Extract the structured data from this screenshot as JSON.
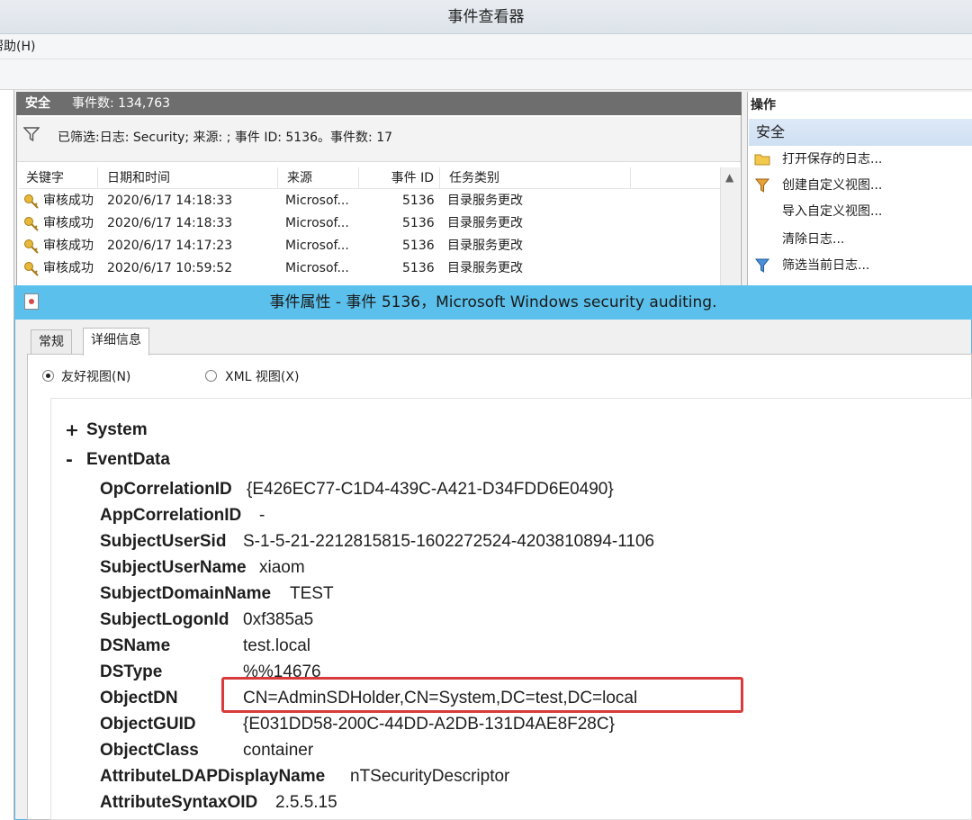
{
  "window": {
    "title": "事件查看器"
  },
  "menu": {
    "help": "帮助(H)"
  },
  "log_pane": {
    "name": "安全",
    "event_count": "事件数: 134,763",
    "filter_text": "已筛选:日志: Security; 来源: ; 事件 ID: 5136。事件数: 17",
    "columns": [
      "关键字",
      "日期和时间",
      "来源",
      "事件 ID",
      "任务类别"
    ],
    "rows": [
      {
        "keyword": "审核成功",
        "datetime": "2020/6/17 14:18:33",
        "source": "Microsof...",
        "event_id": "5136",
        "category": "目录服务更改"
      },
      {
        "keyword": "审核成功",
        "datetime": "2020/6/17 14:18:33",
        "source": "Microsof...",
        "event_id": "5136",
        "category": "目录服务更改"
      },
      {
        "keyword": "审核成功",
        "datetime": "2020/6/17 14:17:23",
        "source": "Microsof...",
        "event_id": "5136",
        "category": "目录服务更改"
      },
      {
        "keyword": "审核成功",
        "datetime": "2020/6/17 10:59:52",
        "source": "Microsof...",
        "event_id": "5136",
        "category": "目录服务更改"
      }
    ]
  },
  "actions": {
    "title": "操作",
    "section": "安全",
    "items": [
      "打开保存的日志...",
      "创建自定义视图...",
      "导入自定义视图...",
      "清除日志...",
      "筛选当前日志..."
    ]
  },
  "dialog": {
    "title": "事件属性 - 事件 5136，Microsoft Windows security auditing.",
    "tabs": [
      "常规",
      "详细信息"
    ],
    "radio_friendly": "友好视图(N)",
    "radio_xml": "XML 视图(X)",
    "system_label": "System",
    "eventdata_label": "EventData",
    "system_toggle": "+",
    "eventdata_toggle": "-",
    "fields": [
      {
        "key": "OpCorrelationID",
        "value": "{E426EC77-C1D4-439C-A421-D34FDD6E0490}"
      },
      {
        "key": "AppCorrelationID",
        "value": "-"
      },
      {
        "key": "SubjectUserSid",
        "value": "S-1-5-21-2212815815-1602272524-4203810894-1106"
      },
      {
        "key": "SubjectUserName",
        "value": "xiaom"
      },
      {
        "key": "SubjectDomainName",
        "value": "TEST"
      },
      {
        "key": "SubjectLogonId",
        "value": "0xf385a5"
      },
      {
        "key": "DSName",
        "value": "test.local"
      },
      {
        "key": "DSType",
        "value": "%%14676"
      },
      {
        "key": "ObjectDN",
        "value": "CN=AdminSDHolder,CN=System,DC=test,DC=local"
      },
      {
        "key": "ObjectGUID",
        "value": "{E031DD58-200C-44DD-A2DB-131D4AE8F28C}"
      },
      {
        "key": "ObjectClass",
        "value": "container"
      },
      {
        "key": "AttributeLDAPDisplayName",
        "value": "nTSecurityDescriptor"
      },
      {
        "key": "AttributeSyntaxOID",
        "value": "2.5.5.15"
      }
    ]
  },
  "colors": {
    "dialog_title_bg": "#5bc0eb",
    "highlight_border": "#d93a3a"
  }
}
